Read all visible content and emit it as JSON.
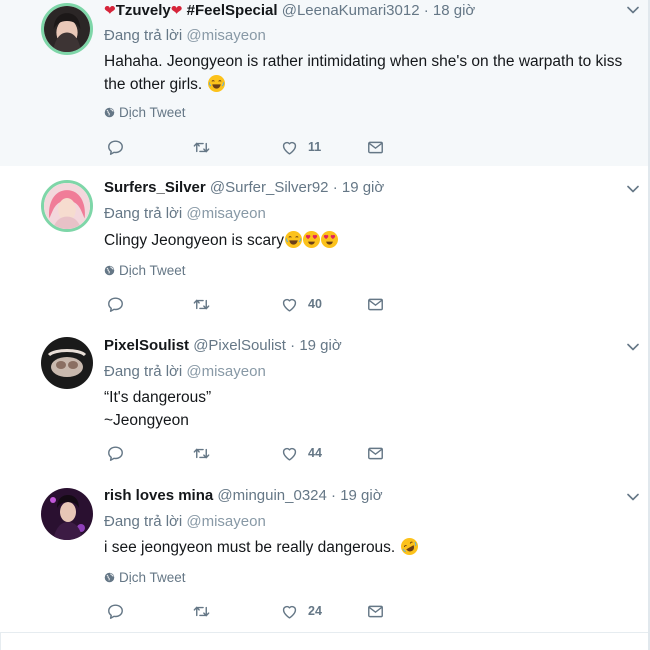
{
  "tweets": [
    {
      "fullname": "Tzuvely",
      "hashtag": "#FeelSpecial",
      "handle": "@LeenaKumari3012",
      "time": "18 giờ",
      "reply_label": "Đang trả lời",
      "reply_to": "@misayeon",
      "text": "Hahaha. Jeongyeon is rather intimidating when she's on the warpath to kiss the other girls.",
      "translate": "Dịch Tweet",
      "likes": "11"
    },
    {
      "fullname": "Surfers_Silver",
      "handle": "@Surfer_Silver92",
      "time": "19 giờ",
      "reply_label": "Đang trả lời",
      "reply_to": "@misayeon",
      "text": "Clingy Jeongyeon is scary",
      "translate": "Dịch Tweet",
      "likes": "40"
    },
    {
      "fullname": "PixelSoulist",
      "handle": "@PixelSoulist",
      "time": "19 giờ",
      "reply_label": "Đang trả lời",
      "reply_to": "@misayeon",
      "text_line1": "“It's dangerous”",
      "text_line2": "~Jeongyeon",
      "likes": "44"
    },
    {
      "fullname": "rish loves mina",
      "handle": "@minguin_0324",
      "time": "19 giờ",
      "reply_label": "Đang trả lời",
      "reply_to": "@misayeon",
      "text": "i see jeongyeon must be really dangerous.",
      "translate": "Dịch Tweet",
      "likes": "24"
    }
  ],
  "colors": {
    "accent_ring": "#7ed6a8",
    "muted": "#657786",
    "heart": "#d6253a",
    "highlight_bg": "#f5f8fa"
  },
  "icons": [
    "reply-icon",
    "retweet-icon",
    "like-icon",
    "dm-icon",
    "globe-icon",
    "chevron-down-icon"
  ]
}
